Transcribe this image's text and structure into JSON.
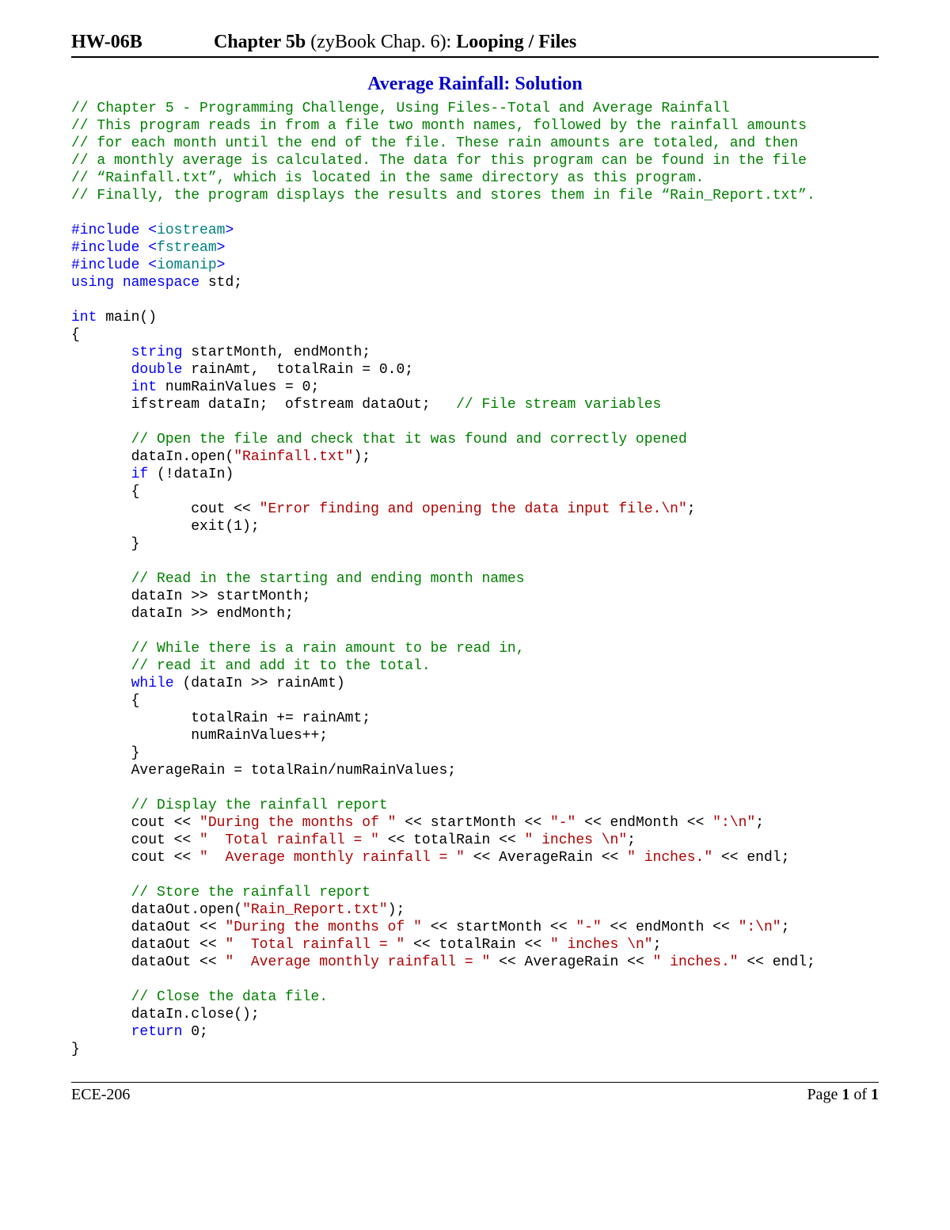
{
  "header": {
    "hw": "HW-06B",
    "chapter_bold": "Chapter 5b",
    "chapter_rest": " (zyBook Chap. 6):  ",
    "chapter_tail_bold": "Looping / Files"
  },
  "title": "Average Rainfall:   Solution",
  "code": {
    "cmt1": "// Chapter 5 - Programming Challenge, Using Files--Total and Average Rainfall",
    "cmt2": "// This program reads in from a file two month names, followed by the rainfall amounts",
    "cmt3": "// for each month until the end of the file. These rain amounts are totaled, and then",
    "cmt4": "// a monthly average is calculated. The data for this program can be found in the file",
    "cmt5": "// “Rainfall.txt”, which is located in the same directory as this program.",
    "cmt6": "// Finally, the program displays the results and stores them in file “Rain_Report.txt”.",
    "inc": "#include",
    "lt": "<",
    "gt": ">",
    "lib1": "iostream",
    "lib2": "fstream",
    "lib3": "iomanip",
    "using": "using",
    "namespace": "namespace",
    "std": " std;",
    "int": "int",
    "main": " main()",
    "lbrace": "{",
    "rbrace": "}",
    "indent": "       ",
    "indent2": "              ",
    "string": "string",
    "decl1": " startMonth, endMonth;",
    "double": "double",
    "decl2": " rainAmt,  totalRain = 0.0;",
    "int2": "int",
    "decl3": " numRainValues = 0;",
    "decl4": "ifstream dataIn;  ofstream dataOut;   ",
    "cmt_fs": "// File stream variables",
    "cmt_open": "// Open the file and check that it was found and correctly opened",
    "open1a": "dataIn.open(",
    "open1b": "\"Rainfall.txt\"",
    "open1c": ");",
    "if": "if",
    "ifcond": " (!dataIn)",
    "cout1a": "cout << ",
    "errstr": "\"Error finding and opening the data input file.\\n\"",
    "semi": ";",
    "exit": "exit(1);",
    "cmt_read": "// Read in the starting and ending month names",
    "read1": "dataIn >> startMonth;",
    "read2": "dataIn >> endMonth;",
    "cmt_while1": "// While there is a rain amount to be read in,",
    "cmt_while2": "// read it and add it to the total.",
    "while": "while",
    "whilecond": " (dataIn >> rainAmt)",
    "body1": "totalRain += rainAmt;",
    "body2": "numRainValues++;",
    "avg": "AverageRain = totalRain/numRainValues;",
    "cmt_disp": "// Display the rainfall report",
    "d1a": "cout << ",
    "s_during": "\"During the months of \"",
    "d1b": " << startMonth << ",
    "s_dash": "\"-\"",
    "d1c": " << endMonth << ",
    "s_colon": "\":\\n\"",
    "d2a": "cout << ",
    "s_total": "\"  Total rainfall = \"",
    "d2b": " << totalRain << ",
    "s_inches_nl": "\" inches \\n\"",
    "d3a": "cout << ",
    "s_avg": "\"  Average monthly rainfall = \"",
    "d3b": " << AverageRain << ",
    "s_inches_dot": "\" inches.\"",
    "d3c": " << endl;",
    "cmt_store": "// Store the rainfall report",
    "store_open_a": "dataOut.open(",
    "store_open_b": "\"Rain_Report.txt\"",
    "store_open_c": ");",
    "o1a": "dataOut << ",
    "cmt_close": "// Close the data file.",
    "close": "dataIn.close();",
    "return": "return",
    "ret0": " 0;"
  },
  "footer": {
    "course": "ECE-206",
    "page_word": "Page ",
    "page_num": "1",
    "page_of": " of ",
    "page_total": "1"
  }
}
